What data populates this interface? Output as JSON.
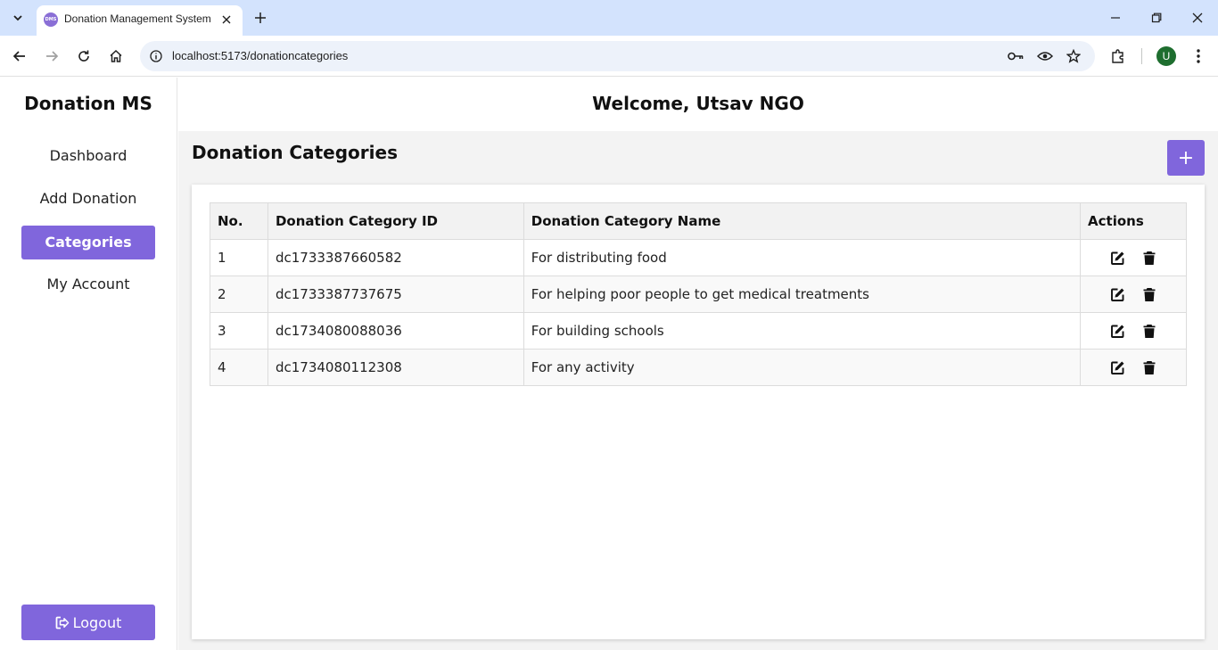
{
  "browser": {
    "tab_title": "Donation Management System",
    "favicon_text": "DMS",
    "url": "localhost:5173/donationcategories",
    "profile_initial": "U"
  },
  "sidebar": {
    "brand": "Donation MS",
    "items": [
      {
        "label": "Dashboard",
        "active": false
      },
      {
        "label": "Add Donation",
        "active": false
      },
      {
        "label": "Categories",
        "active": true
      },
      {
        "label": "My Account",
        "active": false
      }
    ],
    "logout_label": "Logout"
  },
  "header": {
    "welcome": "Welcome, Utsav NGO"
  },
  "main": {
    "title": "Donation Categories",
    "add_button_label": "+",
    "table": {
      "columns": [
        "No.",
        "Donation Category ID",
        "Donation Category Name",
        "Actions"
      ],
      "rows": [
        {
          "no": "1",
          "id": "dc1733387660582",
          "name": "For distributing food"
        },
        {
          "no": "2",
          "id": "dc1733387737675",
          "name": "For helping poor people to get medical treatments"
        },
        {
          "no": "3",
          "id": "dc1734080088036",
          "name": "For building schools"
        },
        {
          "no": "4",
          "id": "dc1734080112308",
          "name": "For any activity"
        }
      ]
    }
  },
  "colors": {
    "accent": "#8066dc",
    "tabbar": "#d3e3fd"
  }
}
